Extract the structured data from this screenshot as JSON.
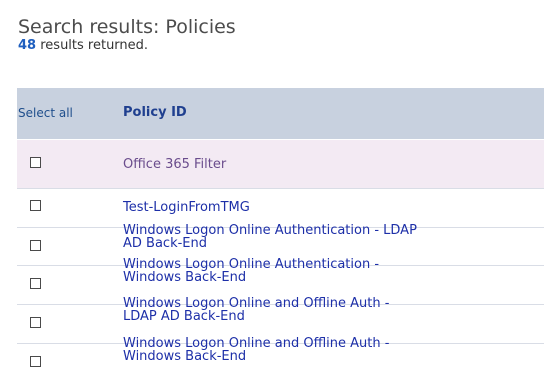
{
  "page": {
    "title": "Search results: Policies",
    "result_count": "48",
    "result_suffix": "results returned."
  },
  "table": {
    "select_all_label": "Select all",
    "column_policy_id": "Policy ID",
    "rows": [
      {
        "lines": [
          "Office 365 Filter"
        ],
        "checked": false
      },
      {
        "lines": [
          "Test-LoginFromTMG"
        ],
        "checked": false
      },
      {
        "lines": [
          "Windows Logon Online Authentication - LDAP",
          "AD Back-End"
        ],
        "checked": false
      },
      {
        "lines": [
          "Windows Logon Online Authentication -",
          "Windows Back-End"
        ],
        "checked": false
      },
      {
        "lines": [
          "Windows Logon Online and Offline Auth -",
          "LDAP AD Back-End"
        ],
        "checked": false
      },
      {
        "lines": [
          "Windows Logon Online and Offline Auth -",
          "Windows Back-End"
        ],
        "checked": false
      }
    ]
  },
  "colors": {
    "header_bg": "#c8d1df",
    "alt_row_bg": "#f3eaf3",
    "link": "#1d2fa8",
    "visited_link": "#6a4c8c",
    "count": "#1f5fbf"
  }
}
